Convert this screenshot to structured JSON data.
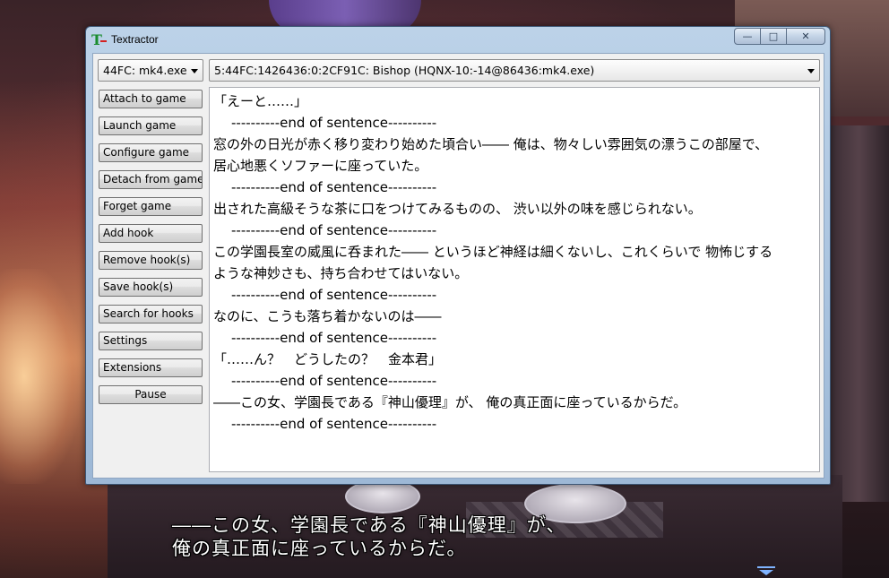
{
  "window": {
    "title": "Textractor"
  },
  "caption_buttons": {
    "minimize": "—",
    "maximize": "□",
    "close": "✕"
  },
  "process_select": {
    "value": "44FC: mk4.exe"
  },
  "hook_select": {
    "value": "5:44FC:1426436:0:2CF91C: Bishop (HQNX-10:-14@86436:mk4.exe)"
  },
  "buttons": [
    {
      "label": "Attach to game"
    },
    {
      "label": "Launch game"
    },
    {
      "label": "Configure game"
    },
    {
      "label": "Detach from game"
    },
    {
      "label": "Forget game"
    },
    {
      "label": "Add hook"
    },
    {
      "label": "Remove hook(s)"
    },
    {
      "label": "Save hook(s)"
    },
    {
      "label": "Search for hooks"
    },
    {
      "label": "Settings"
    },
    {
      "label": "Extensions"
    },
    {
      "label": "Pause"
    }
  ],
  "output_lines": [
    "「えーと……」",
    "----------end of sentence----------",
    "窓の外の日光が赤く移り変わり始めた頃合い―― 俺は、物々しい雰囲気の漂うこの部屋で、",
    "居心地悪くソファーに座っていた。",
    "----------end of sentence----------",
    "出された高級そうな茶に口をつけてみるものの、 渋い以外の味を感じられない。",
    "----------end of sentence----------",
    "この学園長室の威風に呑まれた―― というほど神経は細くないし、これくらいで 物怖じする",
    "ような神妙さも、持ち合わせてはいない。",
    "----------end of sentence----------",
    "なのに、こうも落ち着かないのは――",
    "----------end of sentence----------",
    "「……ん？　どうしたの？　金本君」",
    "----------end of sentence----------",
    "――この女、学園長である『神山優理』が、 俺の真正面に座っているからだ。",
    "----------end of sentence----------"
  ],
  "game_subtitle": {
    "line1": "――この女、学園長である『神山優理』が、",
    "line2": "俺の真正面に座っているからだ。"
  },
  "colors": {
    "titlebar": "#bcd2e8",
    "icon_green": "#1a8c2e",
    "icon_red": "#d42020"
  }
}
